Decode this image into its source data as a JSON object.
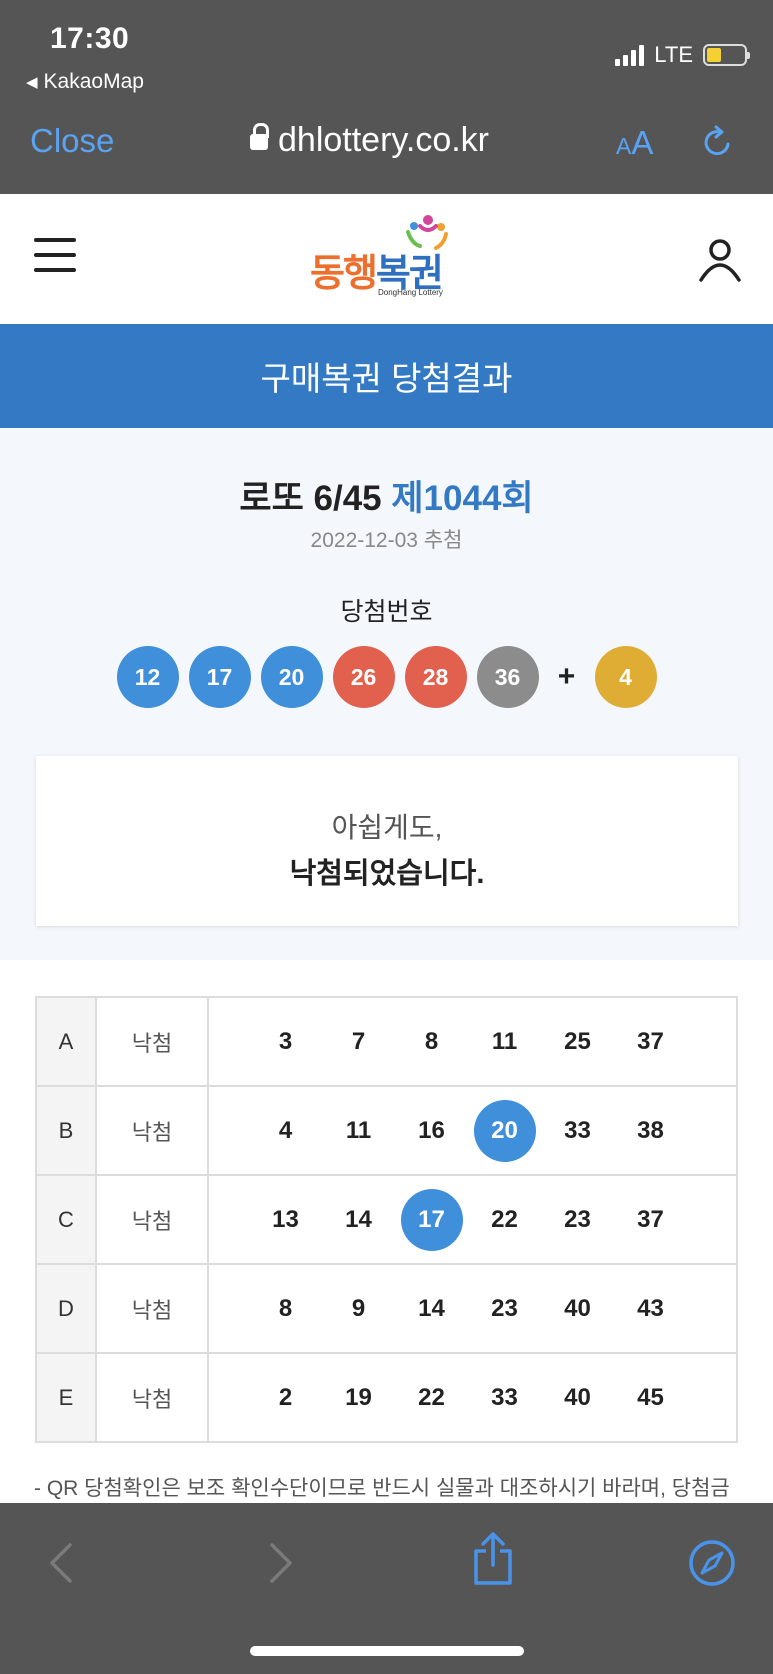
{
  "status_bar": {
    "time": "17:30",
    "back_app": "KakaoMap",
    "network": "LTE"
  },
  "browser": {
    "close_label": "Close",
    "url": "dhlottery.co.kr",
    "text_size_small": "A",
    "text_size_large": "A"
  },
  "site": {
    "logo_text_part1": "동행",
    "logo_text_part2": "복권",
    "logo_sub": "DongHang Lottery",
    "page_title": "구매복권 당첨결과"
  },
  "draw": {
    "game_name": "로또 6/45",
    "round": "제1044회",
    "date": "2022-12-03 추첨",
    "winning_label": "당첨번호",
    "numbers": [
      {
        "value": "12",
        "color": "#3f8fdb"
      },
      {
        "value": "17",
        "color": "#3f8fdb"
      },
      {
        "value": "20",
        "color": "#3f8fdb"
      },
      {
        "value": "26",
        "color": "#e2614e"
      },
      {
        "value": "28",
        "color": "#e2614e"
      },
      {
        "value": "36",
        "color": "#8c8c8c"
      }
    ],
    "plus": "+",
    "bonus": {
      "value": "4",
      "color": "#e0ad34"
    }
  },
  "message": {
    "line1": "아쉽게도,",
    "line2": "낙첨되었습니다."
  },
  "ticket": {
    "rows": [
      {
        "id": "A",
        "result": "낙첨",
        "numbers": [
          "3",
          "7",
          "8",
          "11",
          "25",
          "37"
        ],
        "hits": []
      },
      {
        "id": "B",
        "result": "낙첨",
        "numbers": [
          "4",
          "11",
          "16",
          "20",
          "33",
          "38"
        ],
        "hits": [
          3
        ]
      },
      {
        "id": "C",
        "result": "낙첨",
        "numbers": [
          "13",
          "14",
          "17",
          "22",
          "23",
          "37"
        ],
        "hits": [
          2
        ]
      },
      {
        "id": "D",
        "result": "낙첨",
        "numbers": [
          "8",
          "9",
          "14",
          "23",
          "40",
          "43"
        ],
        "hits": []
      },
      {
        "id": "E",
        "result": "낙첨",
        "numbers": [
          "2",
          "19",
          "22",
          "33",
          "40",
          "45"
        ],
        "hits": []
      }
    ]
  },
  "notice": "- QR 당첨확인은 보조 확인수단이므로 반드시 실물과 대조하시기 바라며, 당첨금",
  "colors": {
    "accent": "#3479c4",
    "chrome": "#555555",
    "ios_link": "#5aa2f2"
  },
  "icons": {
    "menu": "hamburger-icon",
    "user": "user-icon",
    "lock": "lock-icon",
    "reload": "reload-icon",
    "back": "chevron-left-icon",
    "forward": "chevron-right-icon",
    "share": "share-icon",
    "safari": "compass-icon"
  }
}
